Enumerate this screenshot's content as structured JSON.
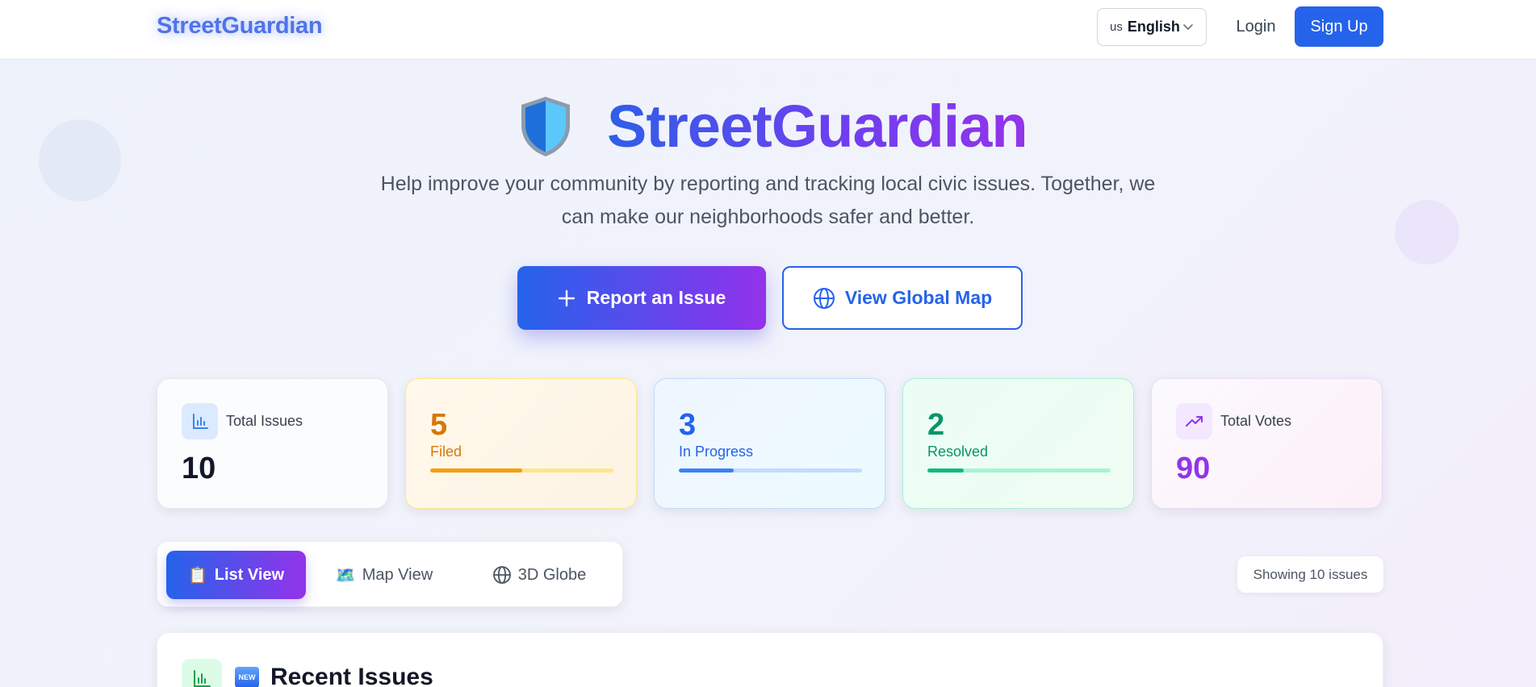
{
  "nav": {
    "brand": "StreetGuardian",
    "language_flag": "us",
    "language": "English",
    "login": "Login",
    "signup": "Sign Up"
  },
  "hero": {
    "title": "StreetGuardian",
    "subtitle": "Help improve your community by reporting and tracking local civic issues. Together, we can make our neighborhoods safer and better.",
    "report_button": "Report an Issue",
    "map_button": "View Global Map"
  },
  "stats": {
    "total_issues": {
      "label": "Total Issues",
      "value": "10",
      "icon": "bar-chart-icon"
    },
    "filed": {
      "value": "5",
      "label": "Filed",
      "progress": 0.5
    },
    "in_progress": {
      "value": "3",
      "label": "In Progress",
      "progress": 0.3
    },
    "resolved": {
      "value": "2",
      "label": "Resolved",
      "progress": 0.2
    },
    "total_votes": {
      "label": "Total Votes",
      "value": "90",
      "icon": "trending-up-icon"
    }
  },
  "views": {
    "list": {
      "emoji": "📋",
      "label": "List View"
    },
    "map": {
      "emoji": "🗺️",
      "label": "Map View"
    },
    "globe": {
      "label": "3D Globe"
    },
    "showing": "Showing 10 issues"
  },
  "recent": {
    "badge": "NEW",
    "title": "Recent Issues"
  },
  "colors": {
    "primary": "#2563eb",
    "purple": "#9333ea",
    "filed": "#d97706",
    "in_progress": "#2563eb",
    "resolved": "#059669"
  }
}
